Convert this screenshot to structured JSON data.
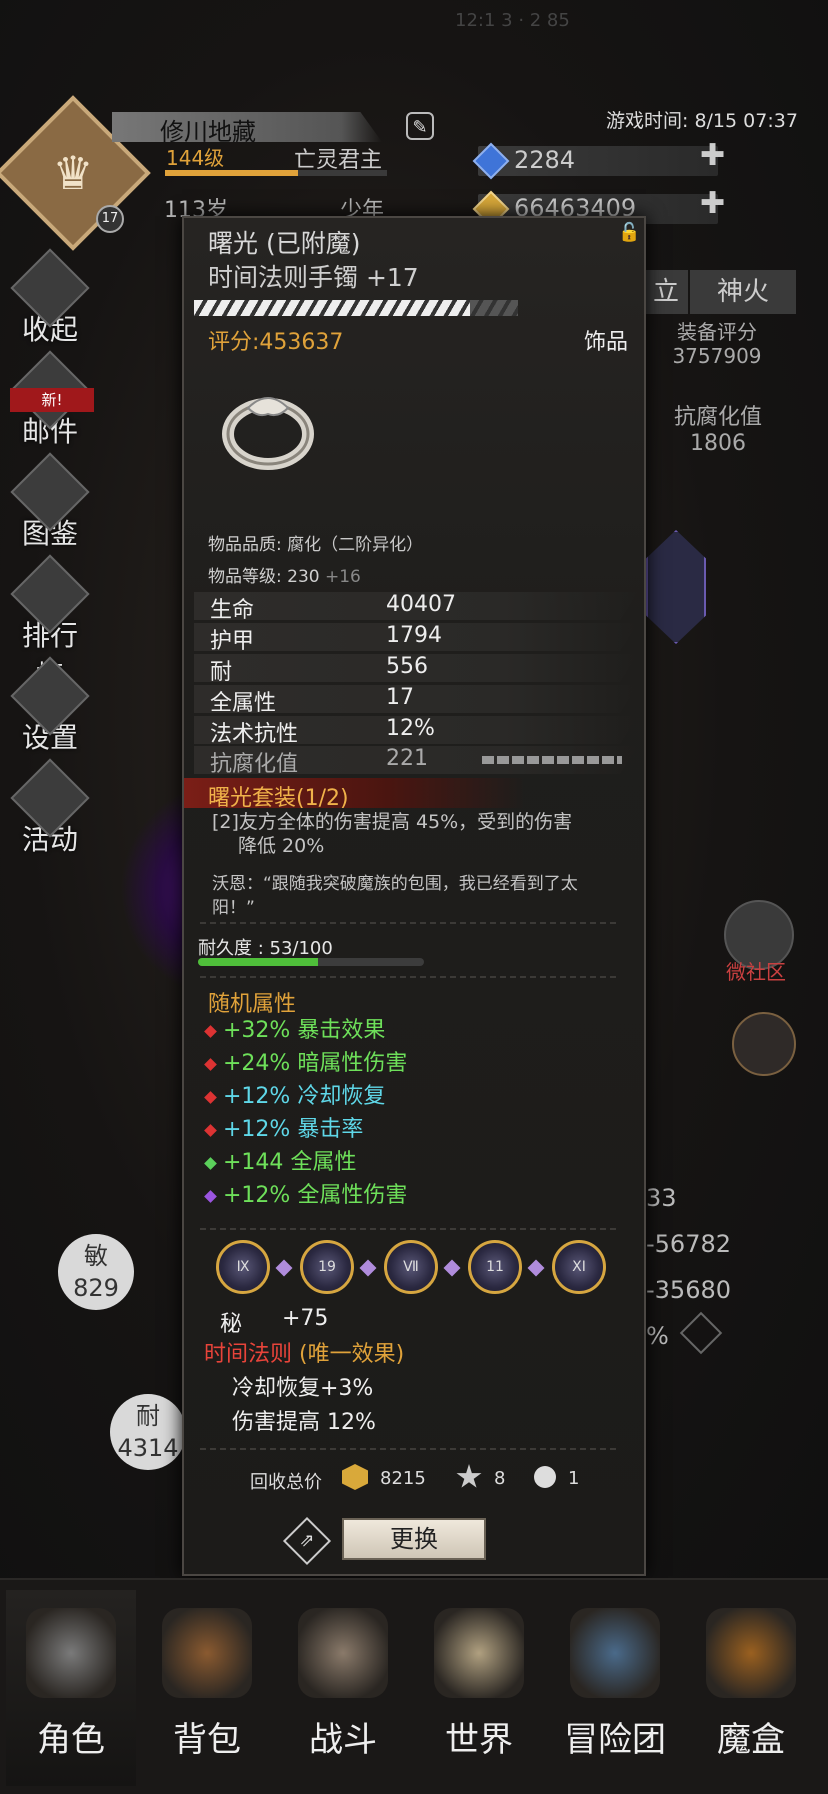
{
  "status_bar": {
    "text": "12:1  3  ·  2  85"
  },
  "header": {
    "player_name": "修川地藏",
    "level": "144级",
    "class_title": "亡灵君主",
    "age": "113岁",
    "age_stage": "少年",
    "avatar_badge": "17",
    "game_time": "游戏时间: 8/15 07:37",
    "xp_fraction": 0.6
  },
  "resources": [
    {
      "name": "blue-gem",
      "value": "2284",
      "color": "#3f74d8"
    },
    {
      "name": "gold",
      "value": "66463409",
      "color": "#d9a93a"
    }
  ],
  "left_menu": [
    {
      "label": "收起",
      "icon": "collapse-icon"
    },
    {
      "label": "邮件",
      "icon": "mail-icon",
      "badge": "新!"
    },
    {
      "label": "图鉴",
      "icon": "book-icon"
    },
    {
      "label": "排行榜",
      "icon": "ranking-icon"
    },
    {
      "label": "设置",
      "icon": "gear-icon"
    },
    {
      "label": "活动",
      "icon": "event-icon"
    }
  ],
  "right_panel": {
    "tab_partial": "立",
    "tab_fire": "神火",
    "equip_score_label": "装备评分",
    "equip_score_value": "3757909",
    "corrupt_label": "抗腐化值",
    "corrupt_value": "1806",
    "community_label": "微社区",
    "partial_values": [
      "33",
      "-56782",
      "-35680",
      "%"
    ]
  },
  "stat_circles": [
    {
      "label": "敏",
      "value": "829"
    },
    {
      "label": "耐",
      "value": "4314"
    }
  ],
  "item": {
    "name_line1": "曙光 (已附魔)",
    "name_line2": "时间法则手镯 +17",
    "score": "评分:453637",
    "slot": "饰品",
    "quality_label": "物品品质: ",
    "quality_value": "腐化（二阶异化）",
    "item_level_label": "物品等级:  230 ",
    "item_level_bonus": "+16",
    "stats": [
      {
        "name": "生命",
        "value": "40407"
      },
      {
        "name": "护甲",
        "value": "1794"
      },
      {
        "name": "耐",
        "value": "556"
      },
      {
        "name": "全属性",
        "value": "17"
      },
      {
        "name": "法术抗性",
        "value": "12%"
      },
      {
        "name": "抗腐化值",
        "value": "221"
      }
    ],
    "set_title": "曙光套装(1/2)",
    "set_desc_line1": "[2]友方全体的伤害提高 45%，受到的伤害",
    "set_desc_line2": "降低 20%",
    "quote_line1": "沃恩：“跟随我突破魔族的包围，我已经看到了太",
    "quote_line2": "阳！”",
    "durability_text": "耐久度 : 53/100",
    "durability_fraction": 0.53,
    "random_title": "随机属性",
    "affixes": [
      {
        "value": "+32%",
        "name": "暴击效果",
        "color": "#6ee05a",
        "dot": "#d33"
      },
      {
        "value": "+24%",
        "name": "暗属性伤害",
        "color": "#6ee05a",
        "dot": "#d33"
      },
      {
        "value": "+12%",
        "name": "冷却恢复",
        "color": "#5fd7e8",
        "dot": "#d33"
      },
      {
        "value": "+12%",
        "name": "暴击率",
        "color": "#5fd7e8",
        "dot": "#d33"
      },
      {
        "value": "+144",
        "name": "全属性",
        "color": "#6ee05a",
        "dot": "#5bd05b"
      },
      {
        "value": "+12%",
        "name": "全属性伤害",
        "color": "#6ee05a",
        "dot": "#9b55e0"
      }
    ],
    "gems": [
      "Ⅸ",
      "19",
      "Ⅶ",
      "11",
      "ⅩⅠ"
    ],
    "secret_label": "秘",
    "secret_value": "+75",
    "law_title": "时间法则",
    "law_suffix": " (唯一效果)",
    "law_lines": [
      "冷却恢复+3%",
      "伤害提高 12%"
    ],
    "recycle_label": "回收总价",
    "recycle_values": [
      "8215",
      "8",
      "1"
    ],
    "replace_button": "更换"
  },
  "bottom_nav": [
    {
      "label": "角色",
      "icon": "helmet-icon"
    },
    {
      "label": "背包",
      "icon": "backpack-icon"
    },
    {
      "label": "战斗",
      "icon": "shield-sword-icon"
    },
    {
      "label": "世界",
      "icon": "scroll-map-icon"
    },
    {
      "label": "冒险团",
      "icon": "castle-icon"
    },
    {
      "label": "魔盒",
      "icon": "magic-box-icon"
    }
  ]
}
